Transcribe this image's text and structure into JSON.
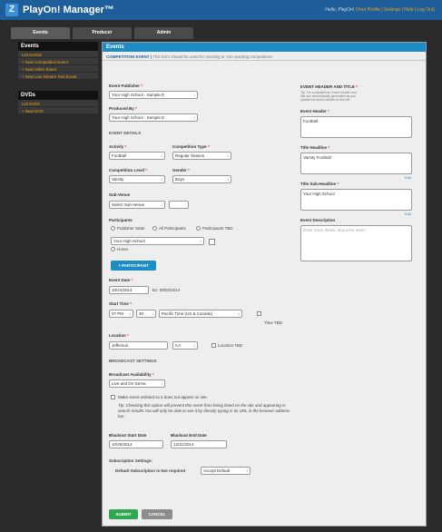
{
  "app": {
    "logo_glyph": "Z",
    "title": "PlayOn! Manager™"
  },
  "user": {
    "prefix": "Hello, PlayOn!",
    "links": "(Your Profile | Settings | Help | Log Out)"
  },
  "tabs": [
    {
      "label": "Events"
    },
    {
      "label": "Producer"
    },
    {
      "label": "Admin"
    }
  ],
  "sidebar": {
    "events_title": "Events",
    "events_items": [
      "List Events",
      "+ New Competition Event",
      "+ New Other Event",
      "+ New Live Stream Test Event"
    ],
    "dvds_title": "DVDs",
    "dvds_items": [
      "List DVDs",
      "+ New DVD"
    ]
  },
  "main": {
    "header": "Events",
    "sub_title": "COMPETITION EVENT",
    "sub_note": "This form should be used for sporting or non-sporting competitions",
    "event_publisher_label": "Event Publisher",
    "event_publisher_value": "Your High School - Sample E",
    "produced_by_label": "Produced By",
    "produced_by_value": "Your High School - Sample E",
    "event_details": "EVENT DETAILS",
    "activity_label": "Activity",
    "activity_value": "Football",
    "competition_type_label": "Competition Type",
    "competition_type_value": "Regular Season",
    "competition_level_label": "Competition Level",
    "competition_level_value": "Varsity",
    "gender_label": "Gender",
    "gender_value": "Boys",
    "sub_venue_label": "Sub-Venue",
    "sub_venue_value": "Select Sub-Venue",
    "participants_label": "Participants",
    "participant_options": [
      "Publisher State",
      "All Participants",
      "Participants TBD"
    ],
    "participant_value": "Your High School",
    "home_label": "Home",
    "add_participant": "+ PARTICIPANT",
    "event_date_label": "Event Date",
    "event_date_value": "10/24/2014",
    "event_date_hint": "Ex: 09/02/2014",
    "start_time_label": "Start Time",
    "start_hour": "07 PM",
    "start_minute": "30",
    "timezone": "Pacific Time (US & Canada)",
    "time_tbd": "Time TBD",
    "location_label": "Location",
    "location_city": "Jefferson",
    "location_state": "CA",
    "location_tbd": "Location TBD",
    "broadcast_settings": "BROADCAST SETTINGS",
    "broadcast_availability_label": "Broadcast Availability",
    "broadcast_availability_value": "Live and On Dema",
    "unlisted_label": "Make event unlisted so it does not appear on site.",
    "unlisted_tip": "Tip: Checking this option will prevent this event from being listed on the site and appearing in search results.You will only be able to see it by directly typing in its URL in the browser address bar.",
    "blackout_start_label": "Blackout Start Date",
    "blackout_start_value": "10/25/2014",
    "blackout_end_label": "Blackout End Date",
    "blackout_end_value": "12/31/2014",
    "subscription_settings": "Subscription Settings:",
    "default_subscription": "Default Subscription is Not required",
    "accept_default": "Accept Default",
    "submit": "SUBMIT",
    "cancel": "CANCEL"
  },
  "right": {
    "header_title": "EVENT HEADER AND TITLE",
    "tip": "Tip: For competitions, event header and title are automatically generated as you update the select details on the left.",
    "event_header_label": "Event Header",
    "event_header_value": "Football",
    "title_headline_label": "Title Headline",
    "title_headline_value": "Varsity Football",
    "title_sub_label": "Title Sub-Headline",
    "title_sub_value": "Your High School",
    "edit": "Edit",
    "description_label": "Event Description",
    "description_placeholder": "Enter more details about the event"
  },
  "colors": {
    "accent": "#1e8cc6",
    "highlight": "#f0a21a",
    "submit": "#2fa84f",
    "cancel": "#8c8c8c"
  }
}
